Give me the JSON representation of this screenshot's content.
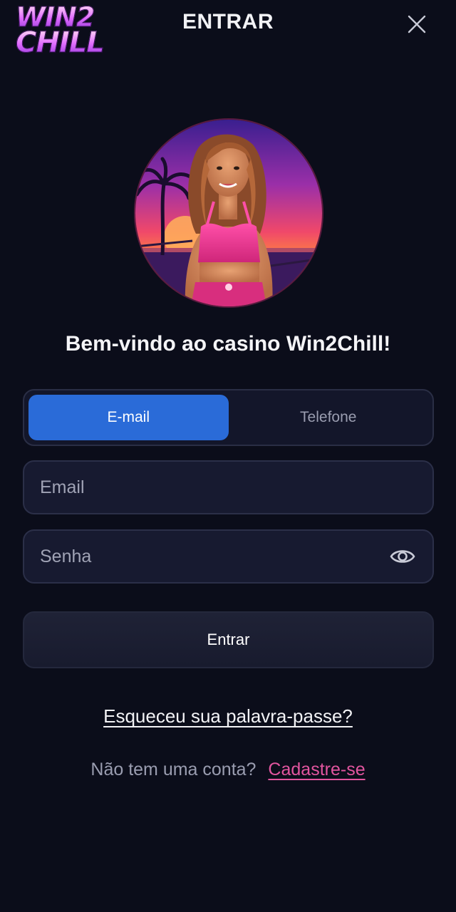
{
  "header": {
    "logo_line1": "WIN2",
    "logo_line2": "CHILL",
    "title": "ENTRAR"
  },
  "welcome": "Bem-vindo ao casino Win2Chill!",
  "tabs": [
    {
      "label": "E-mail",
      "active": true
    },
    {
      "label": "Telefone",
      "active": false
    }
  ],
  "form": {
    "email_placeholder": "Email",
    "email_value": "",
    "password_placeholder": "Senha",
    "password_value": "",
    "submit_label": "Entrar"
  },
  "links": {
    "forgot": "Esqueceu sua palavra-passe?",
    "no_account": "Não tem uma conta?",
    "signup": "Cadastre-se"
  },
  "icons": {
    "close": "close-icon",
    "password_toggle": "eye-icon"
  },
  "colors": {
    "background": "#0b0d1a",
    "accent_blue": "#2a6bd8",
    "signup_pink": "#e2559f"
  }
}
